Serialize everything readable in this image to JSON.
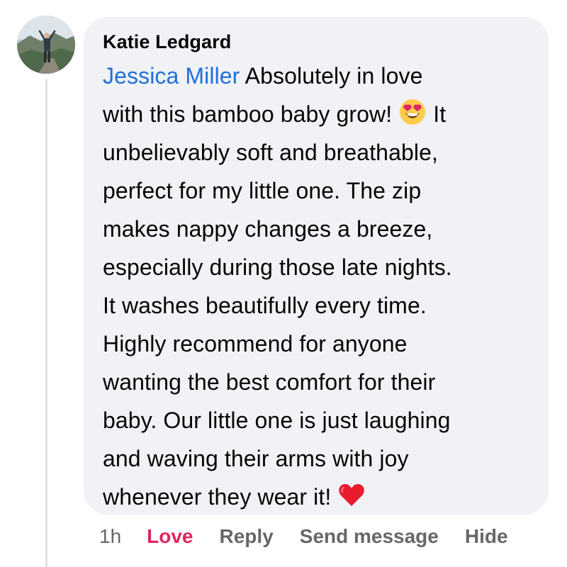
{
  "comment": {
    "author": "Katie Ledgard",
    "mention": "Jessica Miller",
    "lines": [
      " Absolutely in love",
      "with this bamboo baby grow! ",
      " It",
      "unbelievably soft and breathable,",
      "perfect for my little one. The zip",
      "makes nappy changes a breeze,",
      "especially during those late nights.",
      "It washes beautifully every time.",
      "Highly recommend for anyone",
      "wanting the best comfort for their",
      "baby. Our little one is just laughing",
      "and waving their arms with joy",
      "whenever they wear it! "
    ],
    "emojis": [
      "heart-eyes-emoji",
      "red-heart-emoji"
    ]
  },
  "actions": {
    "time": "1h",
    "love": "Love",
    "reply": "Reply",
    "send_message": "Send message",
    "hide": "Hide"
  },
  "colors": {
    "mention": "#216fdb",
    "love": "#e0245e",
    "bubble": "#f0f2f5",
    "muted": "#65676b"
  }
}
